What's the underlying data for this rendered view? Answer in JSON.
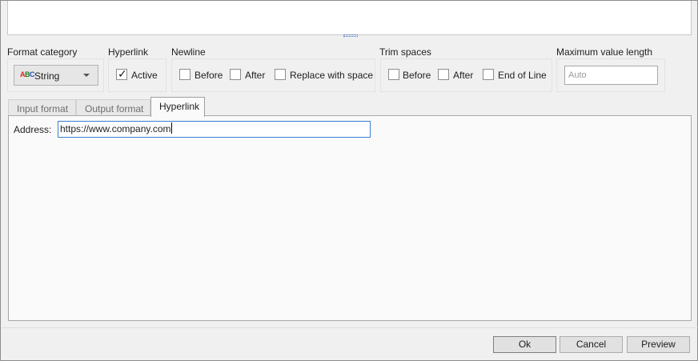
{
  "format_category": {
    "label": "Format category",
    "selected": "String",
    "icon": "abc-string-icon",
    "icon_letters": [
      "A",
      "B",
      "C"
    ]
  },
  "hyperlink": {
    "label": "Hyperlink",
    "active": {
      "label": "Active",
      "checked": true
    }
  },
  "newline": {
    "label": "Newline",
    "options": [
      {
        "label": "Before",
        "checked": false
      },
      {
        "label": "After",
        "checked": false
      },
      {
        "label": "Replace with space",
        "checked": false
      }
    ]
  },
  "trim_spaces": {
    "label": "Trim spaces",
    "options": [
      {
        "label": "Before",
        "checked": false
      },
      {
        "label": "After",
        "checked": false
      },
      {
        "label": "End of Line",
        "checked": false
      }
    ]
  },
  "max_length": {
    "label": "Maximum value length",
    "placeholder": "Auto"
  },
  "tabs": [
    {
      "label": "Input format",
      "active": false
    },
    {
      "label": "Output format",
      "active": false
    },
    {
      "label": "Hyperlink",
      "active": true
    }
  ],
  "hyperlink_tab": {
    "address_label": "Address:",
    "address_value": "https://www.company.com"
  },
  "buttons": {
    "ok": "Ok",
    "cancel": "Cancel",
    "preview": "Preview"
  },
  "colors": {
    "focus_border": "#3c7fd0",
    "abc_a": "#e0241b",
    "abc_b": "#1e7d1e",
    "abc_c": "#2050c0"
  }
}
